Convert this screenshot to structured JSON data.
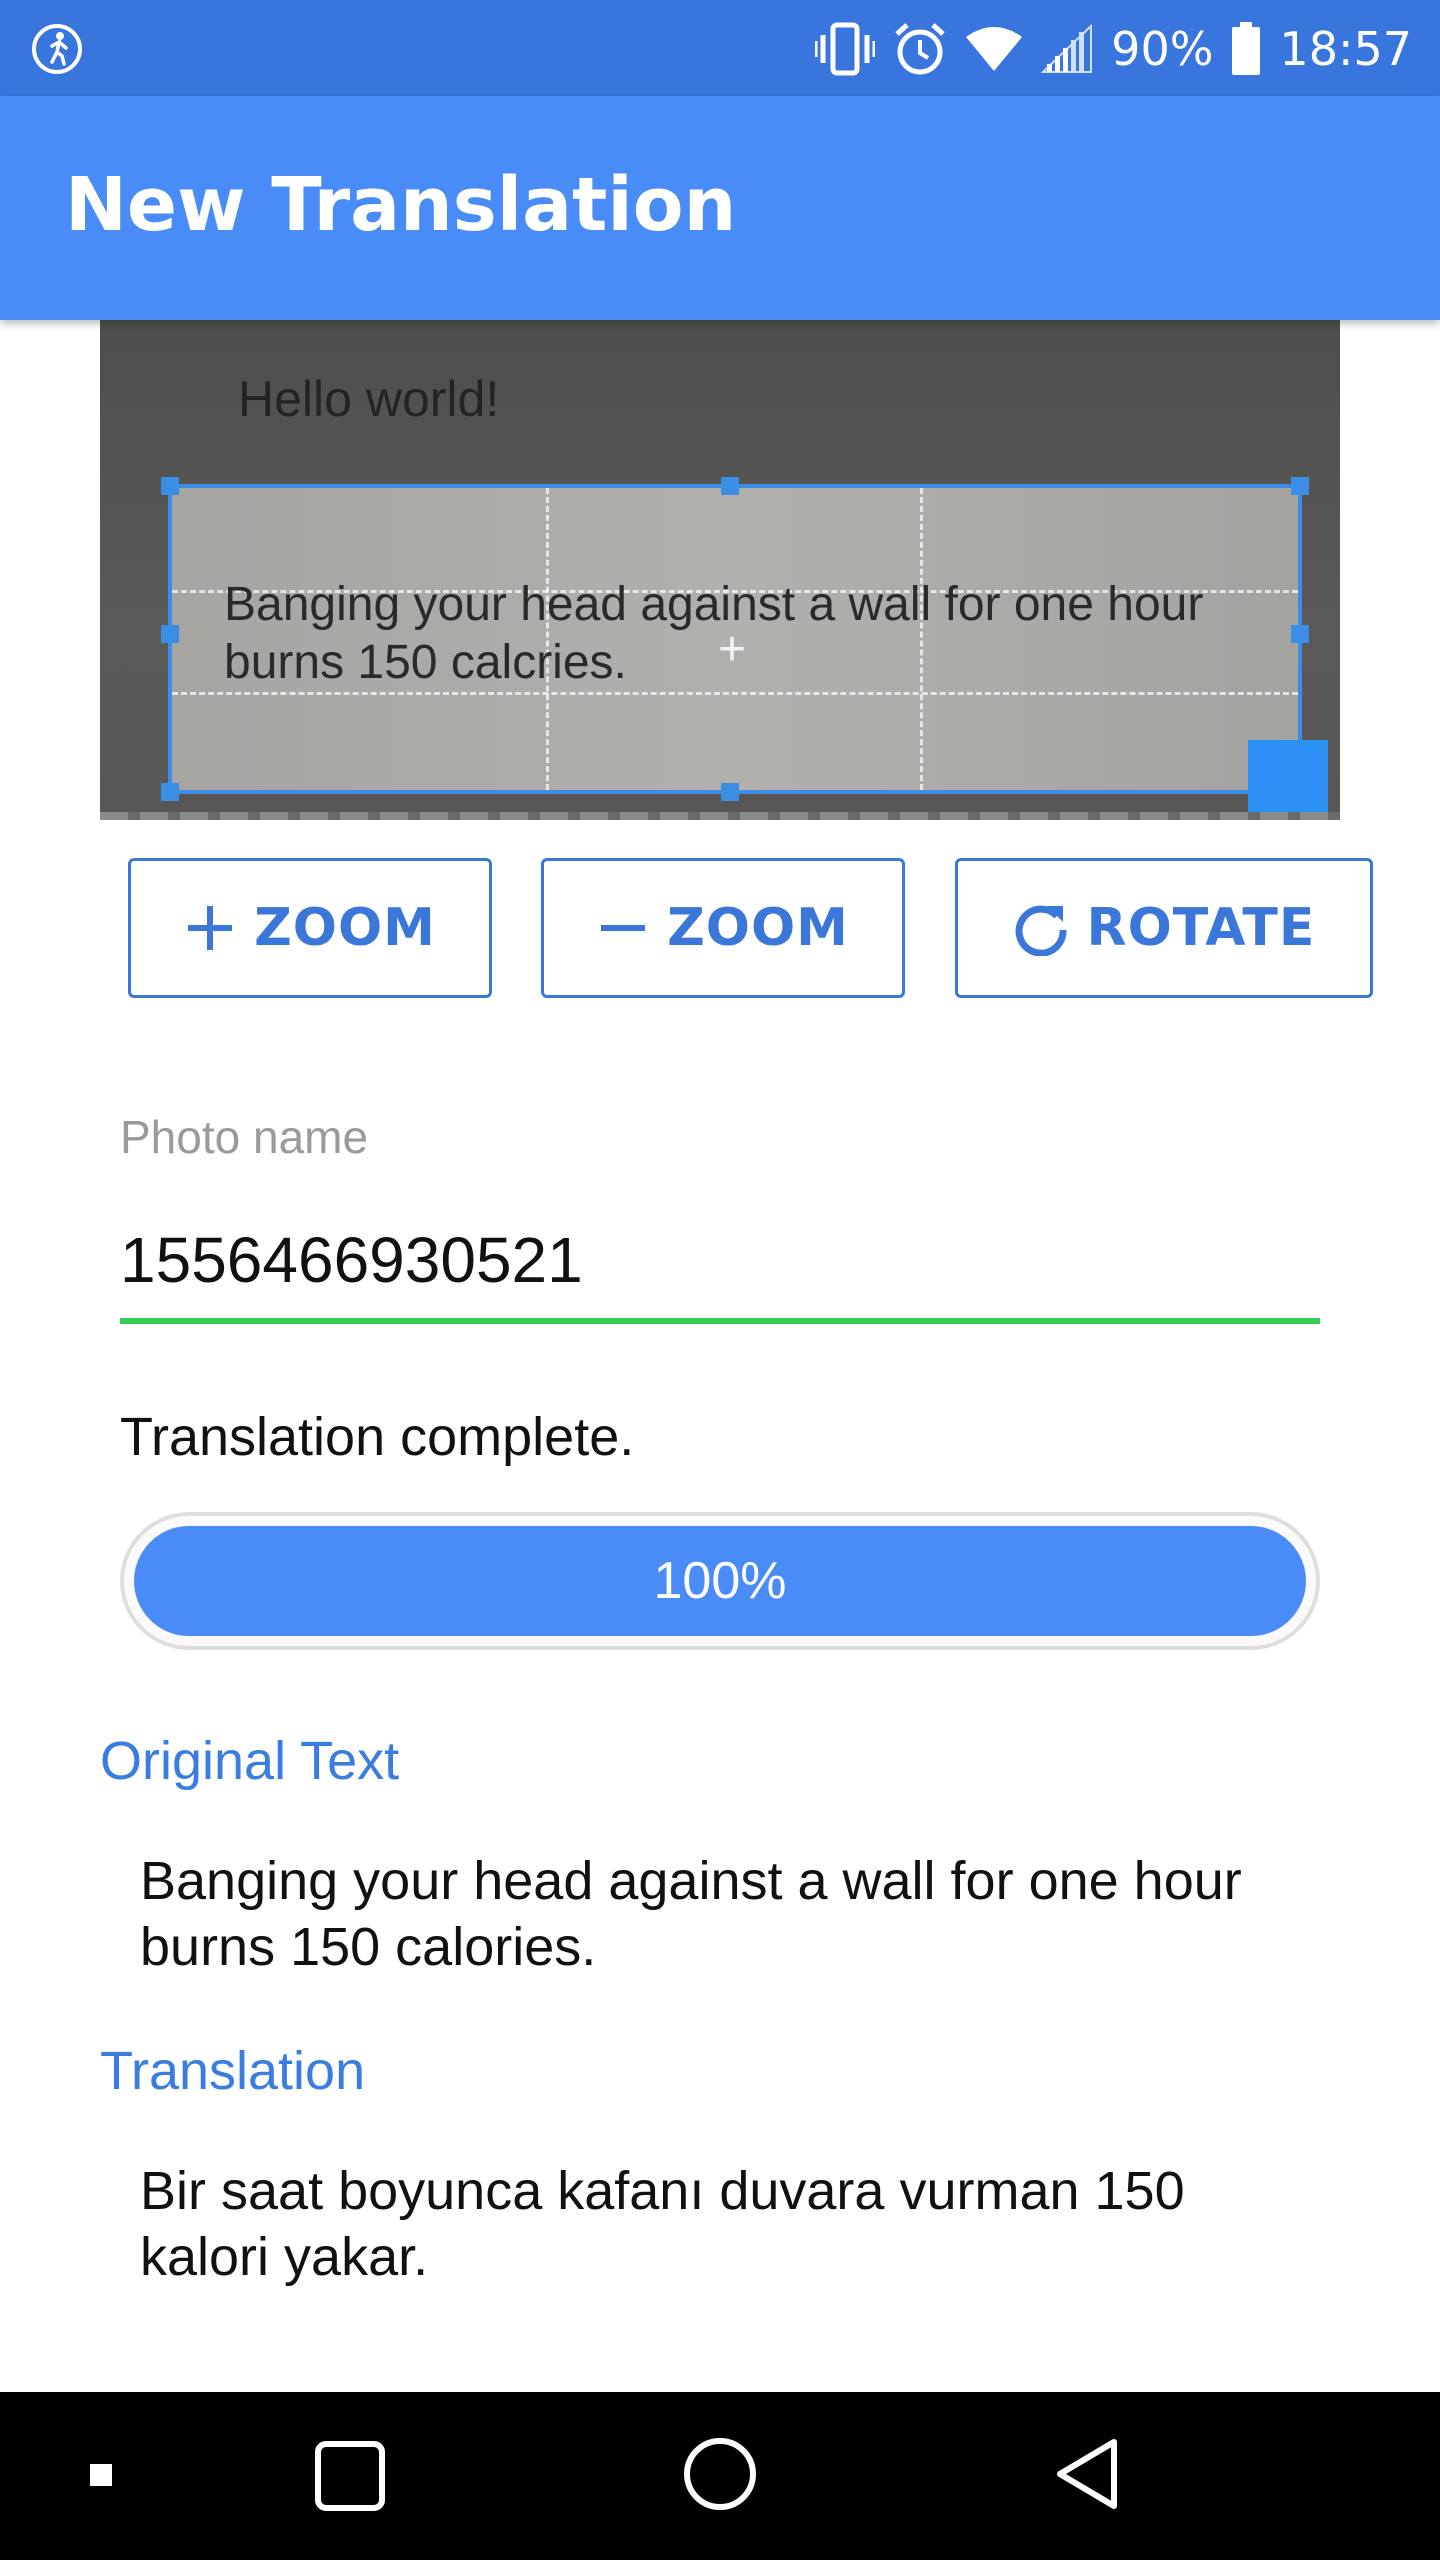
{
  "status_bar": {
    "battery": "90%",
    "time": "18:57",
    "icons": [
      "running-app-icon",
      "vibrate-icon",
      "alarm-icon",
      "wifi-icon",
      "signal-icon",
      "battery-icon"
    ]
  },
  "app_bar": {
    "title": "New Translation"
  },
  "photo": {
    "heading_text": "Hello world!",
    "crop_text_line1": "Banging your head against a wall for one hour",
    "crop_text_line2": "burns 150 calcries."
  },
  "toolbar": {
    "zoom_in_label": "ZOOM",
    "zoom_out_label": "ZOOM",
    "rotate_label": "ROTATE"
  },
  "photo_name": {
    "label": "Photo name",
    "value": "1556466930521"
  },
  "translation_status": "Translation complete.",
  "progress": {
    "percent": 100,
    "label": "100%"
  },
  "original": {
    "title": "Original Text",
    "line1": "Banging your head against a wall for one hour",
    "line2": "burns 150 calories."
  },
  "translation": {
    "title": "Translation",
    "line1": "Bir saat boyunca kafanı duvara vurman 150",
    "line2": "kalori yakar."
  },
  "colors": {
    "status_bar": "#3875dd",
    "app_bar": "#4a8cf7",
    "accent": "#3a77d9",
    "field_underline": "#33cc55",
    "progress_fill": "#4a8cf7"
  },
  "nav_bar": {
    "icons": [
      "recents-dot-icon",
      "square-icon",
      "home-circle-icon",
      "back-triangle-icon"
    ]
  }
}
